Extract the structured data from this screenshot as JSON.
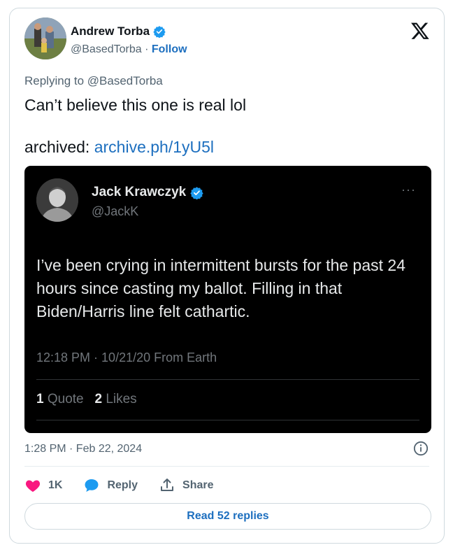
{
  "author": {
    "name": "Andrew Torba",
    "handle": "@BasedTorba",
    "separator": "·",
    "follow_label": "Follow"
  },
  "tweet": {
    "replying_to": "Replying to @BasedTorba",
    "text": "Can’t believe this one is real lol",
    "archived_label": "archived:",
    "archived_link": "archive.ph/1yU5l",
    "timestamp": "1:28 PM · Feb 22, 2024"
  },
  "embedded": {
    "name": "Jack Krawczyk",
    "handle": "@JackK",
    "more": "···",
    "text": "I’ve been crying in intermittent bursts for the past 24 hours since casting my ballot. Filling in that Biden/Harris line felt cathartic.",
    "meta": "12:18 PM · 10/21/20 From Earth",
    "quote_count": "1",
    "quote_label": "Quote",
    "like_count": "2",
    "like_label": "Likes"
  },
  "actions": {
    "like_count": "1K",
    "reply_label": "Reply",
    "share_label": "Share"
  },
  "read_replies_label": "Read 52 replies",
  "colors": {
    "link": "#1d6fbf",
    "verified": "#1d9bf0",
    "heart": "#f91880",
    "embed_bg": "#000000"
  },
  "icons": [
    "verified-badge-icon",
    "x-logo-icon",
    "more-icon",
    "info-icon",
    "heart-icon",
    "reply-bubble-icon",
    "share-icon"
  ]
}
